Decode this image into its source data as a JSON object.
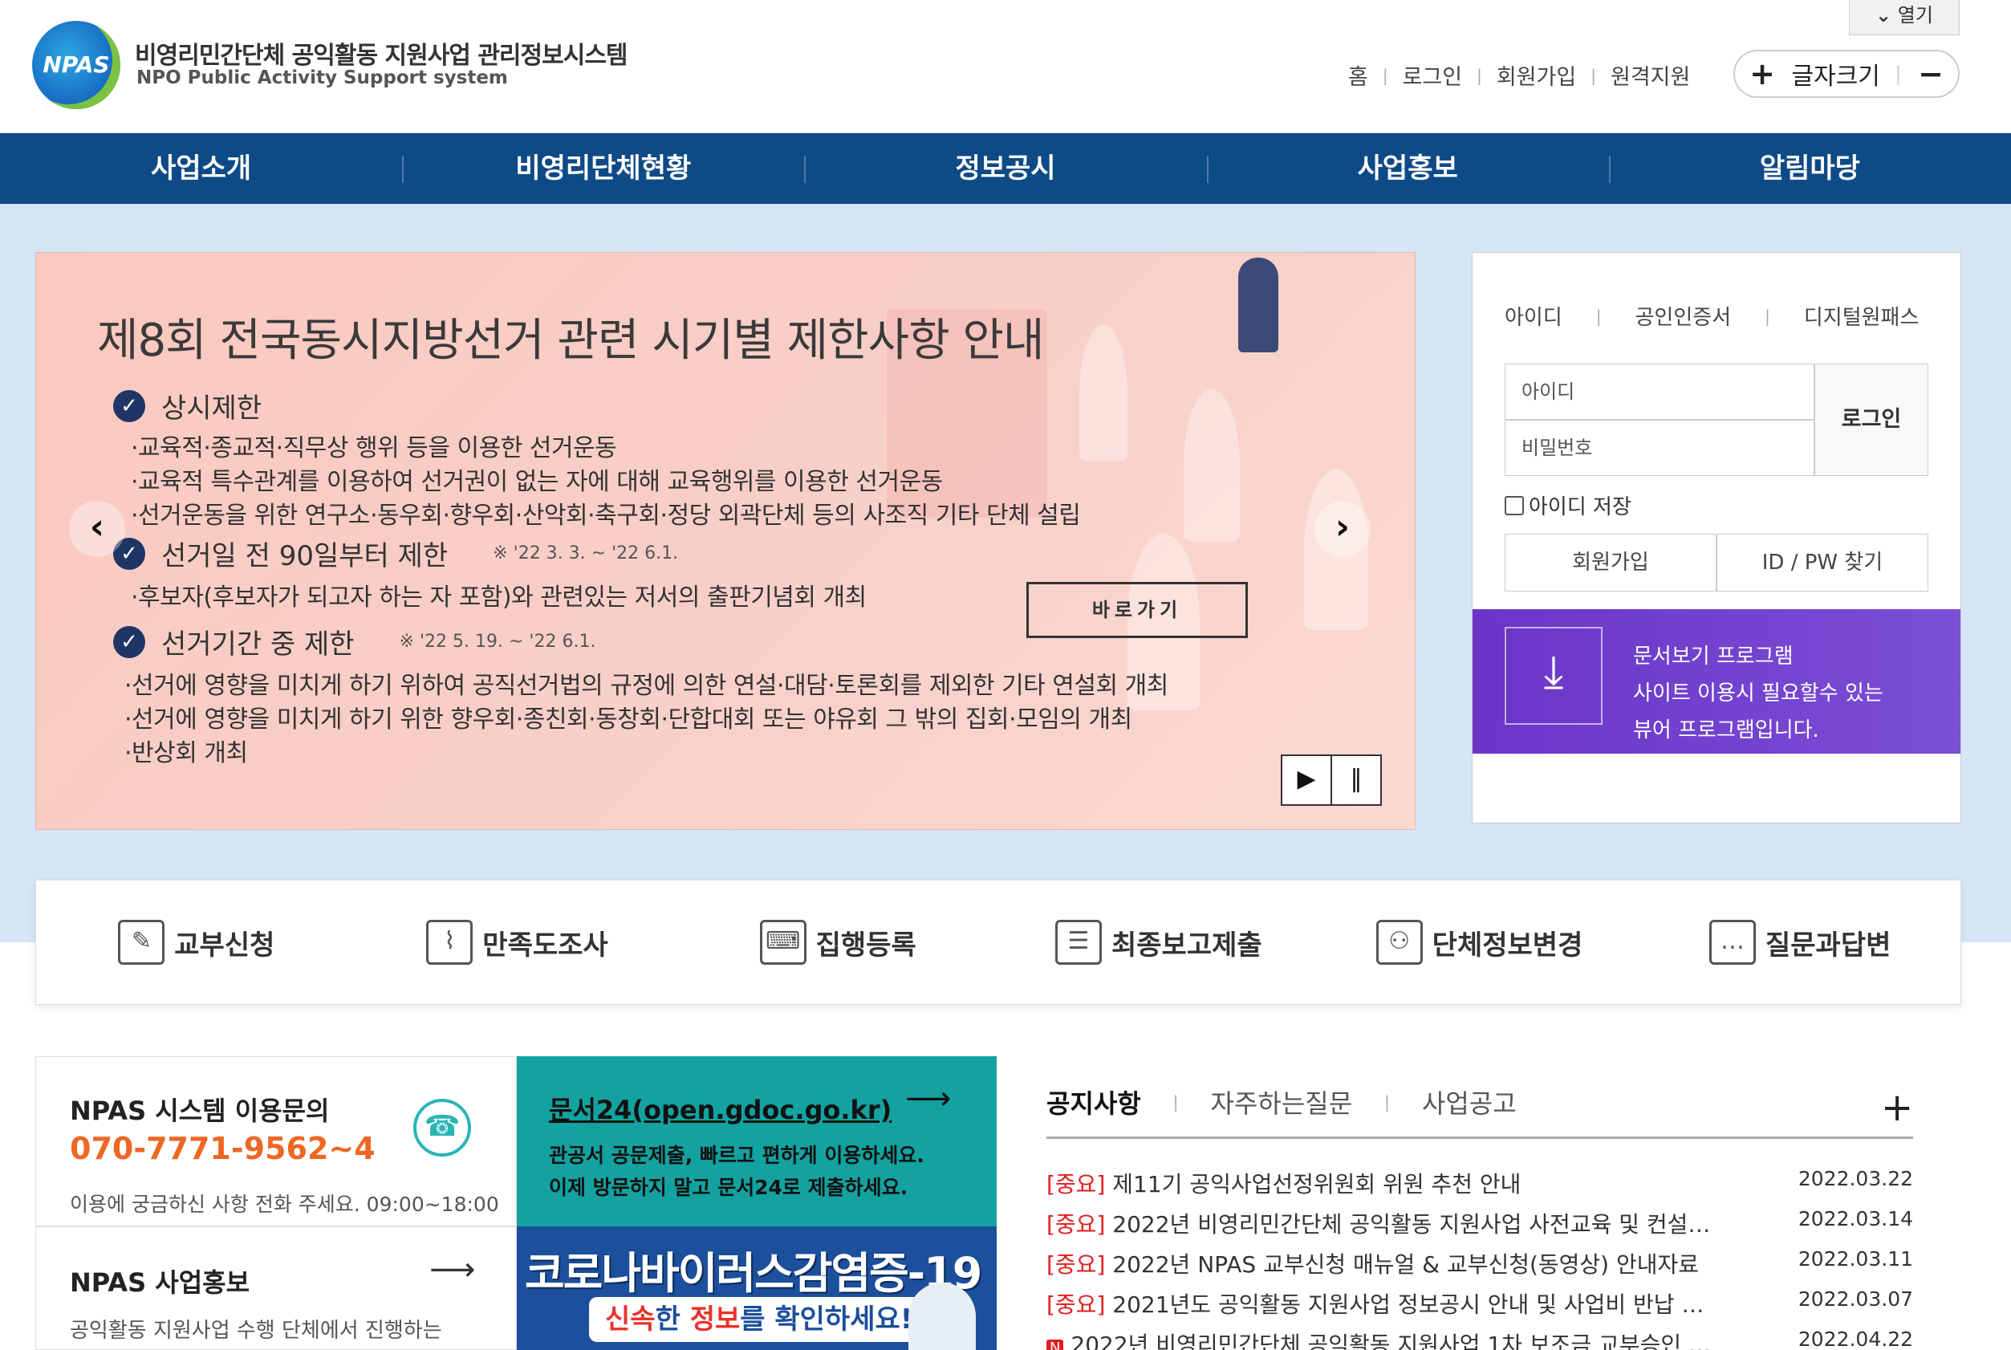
{
  "header": {
    "logo_badge": "NPAS",
    "title": "비영리민간단체 공익활동 지원사업 관리정보시스템",
    "subtitle": "NPO Public Activity Support system",
    "open_tab": "열기",
    "util_links": [
      "홈",
      "로그인",
      "회원가입",
      "원격지원"
    ],
    "font_size_label": "글자크기",
    "font_plus": "+",
    "font_minus": "−"
  },
  "nav": {
    "items": [
      "사업소개",
      "비영리단체현황",
      "정보공시",
      "사업홍보",
      "알림마당"
    ]
  },
  "slide": {
    "title": "제8회 전국동시지방선거 관련 시기별 제한사항 안내",
    "sections": [
      {
        "heading": "상시제한",
        "period": "",
        "items": [
          "·교육적·종교적·직무상 행위 등을 이용한 선거운동",
          "·교육적 특수관계를 이용하여 선거권이 없는 자에 대해 교육행위를 이용한 선거운동",
          "·선거운동을 위한 연구소·동우회·향우회·산악회·축구회·정당 외곽단체 등의 사조직 기타 단체 설립"
        ]
      },
      {
        "heading": "선거일 전 90일부터 제한",
        "period": "※ '22 3. 3. ~ '22 6.1.",
        "items": [
          "·후보자(후보자가 되고자 하는 자 포함)와 관련있는 저서의 출판기념회 개최"
        ]
      },
      {
        "heading": "선거기간 중 제한",
        "period": "※ '22 5. 19. ~ '22 6.1.",
        "items": [
          "·선거에 영향을 미치게 하기 위하여 공직선거법의 규정에 의한 연설·대담·토론회를 제외한 기타 연설회 개최",
          "·선거에 영향을 미치게 하기 위한 향우회·종친회·동창회·단합대회 또는 야유회 그 밖의 집회·모임의 개최",
          "·반상회 개최"
        ]
      }
    ],
    "go_button": "바로가기",
    "prev": "‹",
    "next": "›",
    "play": "▶",
    "pause": "‖"
  },
  "login": {
    "tabs": [
      "아이디",
      "공인인증서",
      "디지털원패스"
    ],
    "id_placeholder": "아이디",
    "pw_placeholder": "비밀번호",
    "login_button": "로그인",
    "save_id": "아이디 저장",
    "join": "회원가입",
    "find": "ID / PW 찾기",
    "viewer_lines": [
      "문서보기 프로그램",
      "사이트 이용시 필요할수 있는",
      "뷰어 프로그램입니다."
    ],
    "viewer_icon": "download-icon"
  },
  "quick_menu": [
    {
      "label": "교부신청",
      "icon": "form-icon"
    },
    {
      "label": "만족도조사",
      "icon": "chart-monitor-icon"
    },
    {
      "label": "집행등록",
      "icon": "keyboard-icon"
    },
    {
      "label": "최종보고제출",
      "icon": "list-icon"
    },
    {
      "label": "단체정보변경",
      "icon": "group-icon"
    },
    {
      "label": "질문과답변",
      "icon": "chat-monitor-icon"
    }
  ],
  "contact": {
    "title": "NPAS 시스템 이용문의",
    "phone": "070-7771-9562~4",
    "desc": "이용에 궁금하신 사항 전화 주세요.  09:00~18:00"
  },
  "promo": {
    "title": "NPAS 사업홍보",
    "desc": "공익활동 지원사업 수행 단체에서 진행하는"
  },
  "gov": {
    "title": "문서24(open.gdoc.go.kr)",
    "desc": [
      "관공서 공문제출, 빠르고 편하게 이용하세요.",
      "이제 방문하지 말고 문서24로 제출하세요."
    ]
  },
  "covid": {
    "title": "코로나바이러스감염증-19",
    "sub_hl1": "신속",
    "sub_mid": "한 ",
    "sub_hl2": "정보",
    "sub_end": "를 확인하세요!"
  },
  "notices": {
    "tabs": [
      "공지사항",
      "자주하는질문",
      "사업공고"
    ],
    "more": "+",
    "rows": [
      {
        "tag": "[중요]",
        "title": "제11기 공익사업선정위원회 위원 추천 안내",
        "date": "2022.03.22"
      },
      {
        "tag": "[중요]",
        "title": "2022년 비영리민간단체 공익활동 지원사업 사전교육 및 컨설…",
        "date": "2022.03.14"
      },
      {
        "tag": "[중요]",
        "title": "2022년 NPAS 교부신청 매뉴얼 & 교부신청(동영상) 안내자료",
        "date": "2022.03.11"
      },
      {
        "tag": "[중요]",
        "title": "2021년도 공익활동 지원사업 정보공시 안내 및 사업비 반납 …",
        "date": "2022.03.07"
      },
      {
        "tag": "N",
        "title": "2022년 비영리민간단체 공익활동 지원사업 1차 보조금 교부승인 …",
        "date": "2022.04.22"
      }
    ]
  }
}
